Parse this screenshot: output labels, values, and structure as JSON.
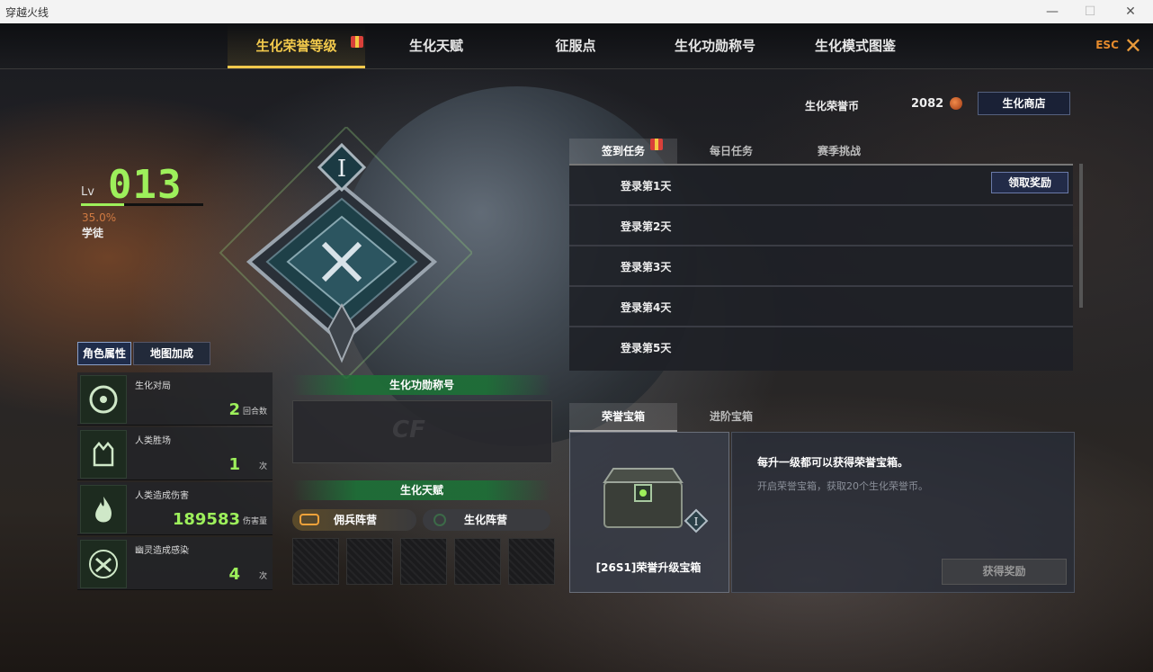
{
  "window": {
    "title": "穿越火线",
    "minimize": "—",
    "maximize": "☐",
    "close": "✕"
  },
  "nav": {
    "tabs": [
      {
        "label": "生化荣誉等级",
        "active": true,
        "gift": true
      },
      {
        "label": "生化天赋"
      },
      {
        "label": "征服点"
      },
      {
        "label": "生化功勋称号"
      },
      {
        "label": "生化模式图鉴"
      }
    ],
    "esc_label": "ESC",
    "close_glyph": "✕"
  },
  "level": {
    "prefix": "Lv",
    "value": "013",
    "progress_pct": 35.0,
    "progress_text": "35.0%",
    "rank": "学徒",
    "accent": "#9df05b"
  },
  "emblem": {
    "roman": "I"
  },
  "stat_tabs": [
    "角色属性",
    "地图加成"
  ],
  "stats": [
    {
      "label": "生化对局",
      "value": "2",
      "unit": "回合数",
      "icon": "biohazard-badge-icon"
    },
    {
      "label": "人类胜场",
      "value": "1",
      "unit": "次",
      "icon": "crown-book-icon"
    },
    {
      "label": "人类造成伤害",
      "value": "189583",
      "unit": "伤害量",
      "icon": "flame-icon"
    },
    {
      "label": "幽灵造成感染",
      "value": "4",
      "unit": "次",
      "icon": "infection-icon"
    }
  ],
  "middle": {
    "title_header": "生化功勋称号",
    "title_logo": "CF",
    "talent_header": "生化天赋",
    "camps": [
      "佣兵阵营",
      "生化阵营"
    ]
  },
  "currency": {
    "label": "生化荣誉币",
    "value": "2082",
    "shop_button": "生化商店"
  },
  "task_tabs": [
    {
      "label": "签到任务",
      "active": true,
      "gift": true
    },
    {
      "label": "每日任务"
    },
    {
      "label": "赛季挑战"
    }
  ],
  "tasks": [
    {
      "label": "登录第1天",
      "button": "领取奖励"
    },
    {
      "label": "登录第2天"
    },
    {
      "label": "登录第3天"
    },
    {
      "label": "登录第4天"
    },
    {
      "label": "登录第5天"
    }
  ],
  "box_tabs": [
    {
      "label": "荣誉宝箱",
      "active": true
    },
    {
      "label": "进阶宝箱"
    }
  ],
  "box": {
    "name": "[26S1]荣誉升级宝箱",
    "info_title": "每升一级都可以获得荣誉宝箱。",
    "info_desc": "开启荣誉宝箱，获取20个生化荣誉币。",
    "button": "获得奖励",
    "roman": "I"
  }
}
